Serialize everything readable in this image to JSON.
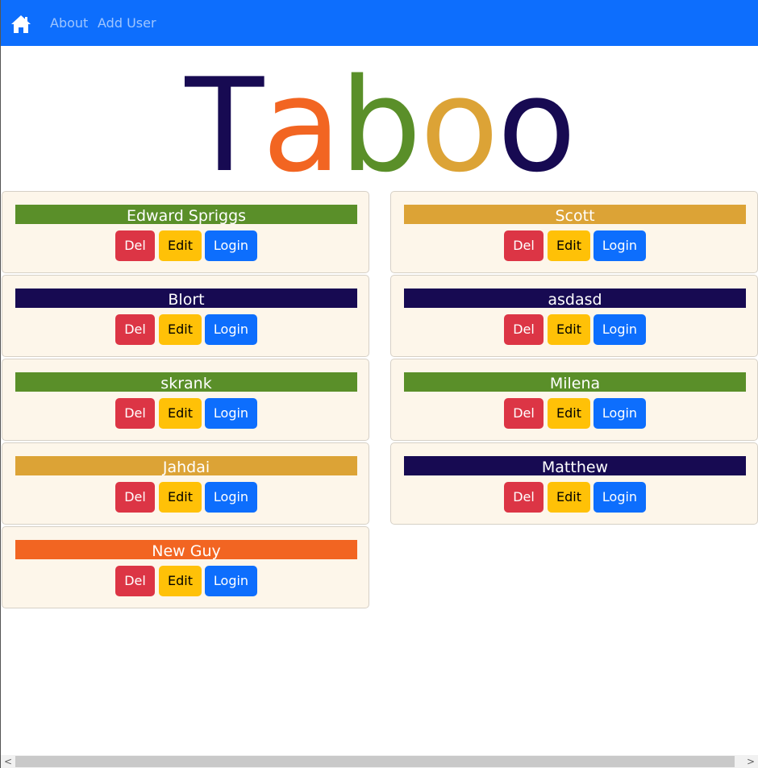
{
  "navbar": {
    "home_icon": "home-icon",
    "links": [
      "About",
      "Add User"
    ],
    "background": "#0d6efd"
  },
  "title": {
    "letters": [
      {
        "char": "T",
        "color": "#170a52"
      },
      {
        "char": "a",
        "color": "#f26522"
      },
      {
        "char": "b",
        "color": "#5a8f29"
      },
      {
        "char": "o",
        "color": "#dca336"
      },
      {
        "char": "o",
        "color": "#170a52"
      }
    ]
  },
  "buttons": {
    "delete_label": "Del",
    "edit_label": "Edit",
    "login_label": "Login"
  },
  "users": [
    {
      "name": "Edward Spriggs",
      "color": "#5a8f29"
    },
    {
      "name": "Scott",
      "color": "#dca336"
    },
    {
      "name": "Blort",
      "color": "#170a52"
    },
    {
      "name": "asdasd",
      "color": "#170a52"
    },
    {
      "name": "skrank",
      "color": "#5a8f29"
    },
    {
      "name": "Milena",
      "color": "#5a8f29"
    },
    {
      "name": "Jahdai",
      "color": "#dca336"
    },
    {
      "name": "Matthew",
      "color": "#170a52"
    },
    {
      "name": "New Guy",
      "color": "#f26522"
    }
  ],
  "scrollbar": {
    "left_arrow": "<",
    "right_arrow": ">"
  }
}
